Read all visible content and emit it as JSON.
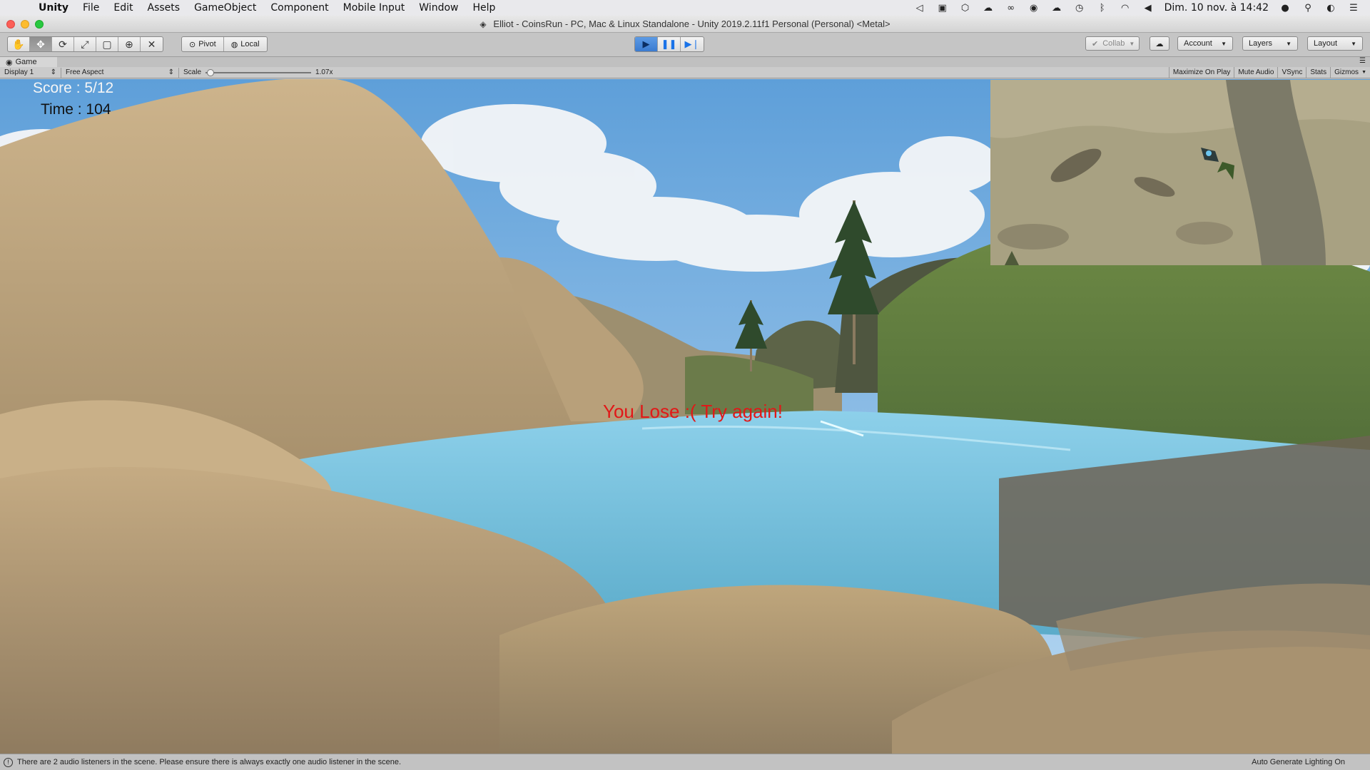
{
  "menubar": {
    "app": "Unity",
    "items": [
      "File",
      "Edit",
      "Assets",
      "GameObject",
      "Component",
      "Mobile Input",
      "Window",
      "Help"
    ],
    "clock": "Dim. 10 nov. à 14:42"
  },
  "window": {
    "title": "Elliot - CoinsRun - PC, Mac & Linux Standalone - Unity 2019.2.11f1 Personal (Personal) <Metal>"
  },
  "toolbar": {
    "pivot_label": "Pivot",
    "local_label": "Local",
    "collab_label": "Collab",
    "account_label": "Account",
    "layers_label": "Layers",
    "layout_label": "Layout"
  },
  "game_view": {
    "tab_label": "Game",
    "display_label": "Display 1",
    "aspect_label": "Free Aspect",
    "scale_label": "Scale",
    "scale_value": "1.07x",
    "toggles": [
      "Maximize On Play",
      "Mute Audio",
      "VSync",
      "Stats",
      "Gizmos"
    ]
  },
  "hud": {
    "score": "Score : 5/12",
    "time": "Time : 104",
    "message": "You Lose :( Try again!"
  },
  "statusbar": {
    "message": "There are 2 audio listeners in the scene. Please ensure there is always exactly one audio listener in the scene.",
    "right": "Auto Generate Lighting On"
  },
  "colors": {
    "play_active": "#3b7bd0",
    "lose_text": "#e11818"
  }
}
